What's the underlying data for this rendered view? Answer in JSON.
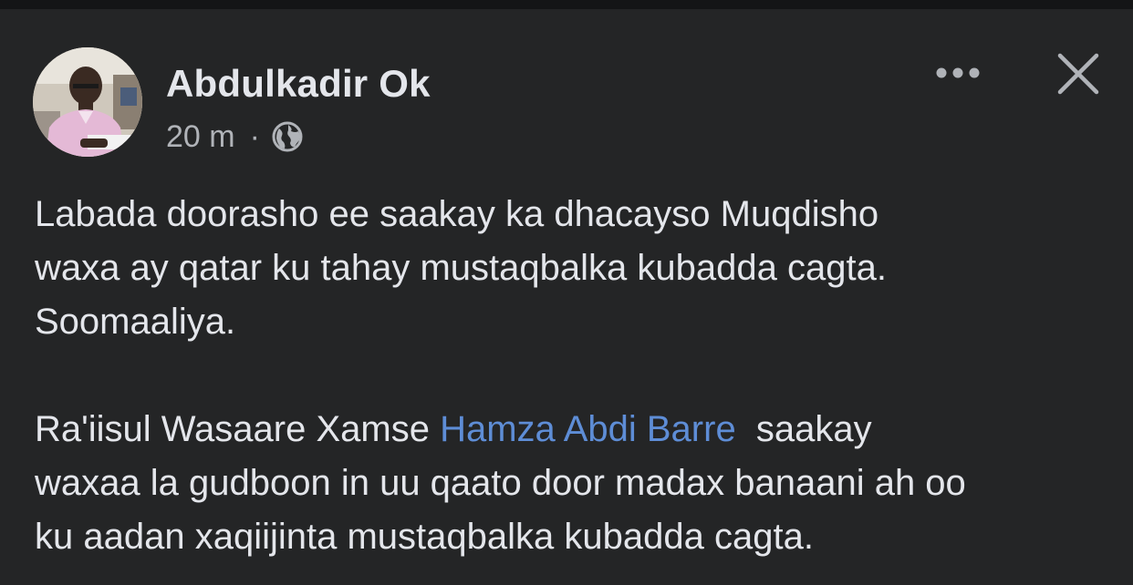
{
  "post": {
    "author": "Abdulkadir Ok",
    "time": "20 m",
    "separator": "·",
    "audience_icon": "globe-icon",
    "actions": {
      "more_icon": "more-horizontal-icon",
      "close_icon": "close-icon"
    },
    "paragraph1": [
      "Labada doorasho ee saakay ka dhacayso Muqdisho",
      "waxa ay qatar ku tahay mustaqbalka kubadda cagta.",
      "Soomaaliya."
    ],
    "paragraph2": {
      "line1_before": "Ra'iisul Wasaare Xamse ",
      "mention": "Hamza Abdi Barre",
      "line1_after": "  saakay",
      "line2": "waxaa la gudboon in uu qaato door madax banaani ah oo",
      "line3": "ku aadan xaqiijinta mustaqbalka kubadda cagta."
    }
  },
  "colors": {
    "background": "#242526",
    "text": "#e4e6eb",
    "secondary_text": "#b0b3b8",
    "mention": "#5e8dd6"
  }
}
